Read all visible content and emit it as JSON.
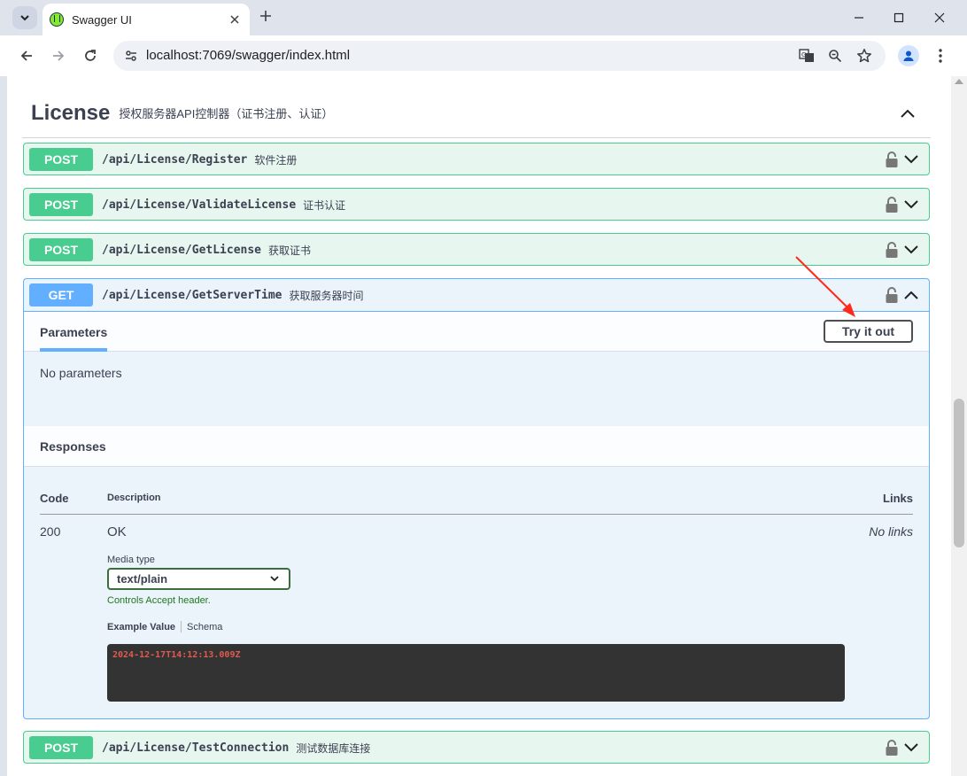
{
  "browser": {
    "tab_title": "Swagger UI",
    "url": "localhost:7069/swagger/index.html"
  },
  "tag": {
    "name": "License",
    "description": "授权服务器API控制器（证书注册、认证）"
  },
  "operations": [
    {
      "method": "POST",
      "path": "/api/License/Register",
      "summary": "软件注册"
    },
    {
      "method": "POST",
      "path": "/api/License/ValidateLicense",
      "summary": "证书认证"
    },
    {
      "method": "POST",
      "path": "/api/License/GetLicense",
      "summary": "获取证书"
    },
    {
      "method": "GET",
      "path": "/api/License/GetServerTime",
      "summary": "获取服务器时间"
    },
    {
      "method": "POST",
      "path": "/api/License/TestConnection",
      "summary": "测试数据库连接"
    }
  ],
  "expanded": {
    "parameters_tab": "Parameters",
    "try_it_out_label": "Try it out",
    "no_parameters": "No parameters",
    "responses_title": "Responses",
    "columns": {
      "code": "Code",
      "description": "Description",
      "links": "Links"
    },
    "response": {
      "code": "200",
      "description": "OK",
      "links": "No links",
      "media_type_label": "Media type",
      "media_type_value": "text/plain",
      "accept_note": "Controls Accept header.",
      "example_tab": "Example Value",
      "schema_tab": "Schema",
      "example_code": "2024-12-17T14:12:13.009Z"
    }
  },
  "colors": {
    "post": "#49cc90",
    "get": "#61affe",
    "annotation_arrow": "#ff2a1a"
  }
}
